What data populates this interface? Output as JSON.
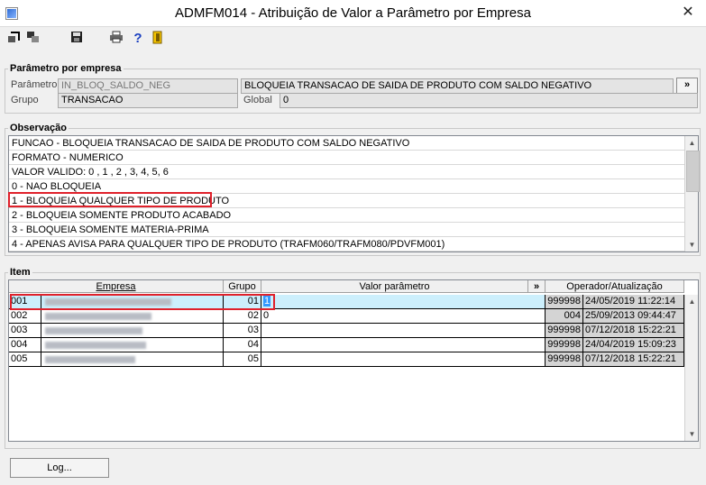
{
  "window": {
    "title": "ADMFM014 - Atribuição de Valor a Parâmetro por Empresa",
    "close_glyph": "✕"
  },
  "toolbar": {
    "icons": [
      "export-icon",
      "copy-icon",
      "save-icon",
      "print-icon",
      "help-icon",
      "exit-icon"
    ]
  },
  "param_group": {
    "legend": "Parâmetro por empresa",
    "parametro_label": "Parâmetro",
    "parametro_value": "IN_BLOQ_SALDO_NEG",
    "descricao_value": "BLOQUEIA TRANSACAO DE SAIDA DE PRODUTO COM SALDO NEGATIVO",
    "more_label": "»",
    "grupo_label": "Grupo",
    "grupo_value": "TRANSACAO",
    "global_label": "Global",
    "global_value": "0"
  },
  "obs_group": {
    "legend": "Observação",
    "lines": [
      "FUNCAO - BLOQUEIA TRANSACAO DE SAIDA DE PRODUTO COM SALDO NEGATIVO",
      "FORMATO - NUMERICO",
      "VALOR VALIDO: 0 , 1 , 2 , 3, 4, 5, 6",
      "0 - NAO BLOQUEIA",
      "1 - BLOQUEIA QUALQUER TIPO DE PRODUTO",
      "2 - BLOQUEIA SOMENTE PRODUTO ACABADO",
      "3 - BLOQUEIA SOMENTE MATERIA-PRIMA",
      "4 - APENAS AVISA PARA QUALQUER TIPO DE PRODUTO (TRAFM060/TRAFM080/PDVFM001)"
    ],
    "highlighted_line": 4
  },
  "item_group": {
    "legend": "Item",
    "columns": {
      "empresa": "Empresa",
      "grupo": "Grupo",
      "valor": "Valor parâmetro",
      "more": "»",
      "operador": "Operador/Atualização"
    },
    "rows": [
      {
        "codigo": "001",
        "grupo": "01",
        "valor": "1",
        "operador": "999998",
        "data": "24/05/2019 11:22:14"
      },
      {
        "codigo": "002",
        "grupo": "02",
        "valor": "0",
        "operador": "004",
        "data": "25/09/2013 09:44:47"
      },
      {
        "codigo": "003",
        "grupo": "03",
        "valor": "",
        "operador": "999998",
        "data": "07/12/2018 15:22:21"
      },
      {
        "codigo": "004",
        "grupo": "04",
        "valor": "",
        "operador": "999998",
        "data": "24/04/2019 15:09:23"
      },
      {
        "codigo": "005",
        "grupo": "05",
        "valor": "",
        "operador": "999998",
        "data": "07/12/2018 15:22:21"
      }
    ]
  },
  "footer": {
    "log_button": "Log..."
  },
  "colors": {
    "selected_row": "#cceffc",
    "highlight": "#e0212b"
  }
}
